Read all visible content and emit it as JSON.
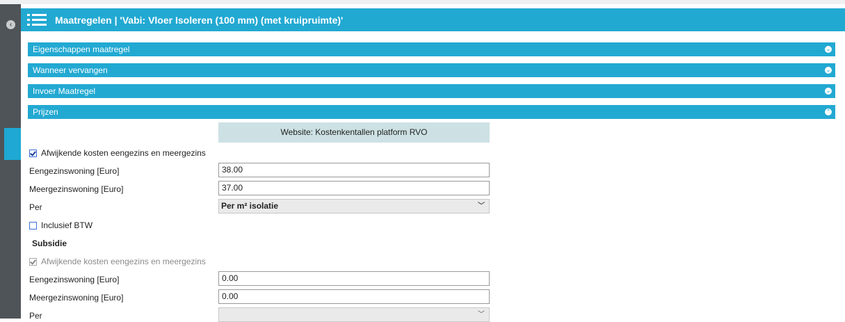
{
  "header": {
    "title": "Maatregelen | 'Vabi: Vloer Isoleren (100 mm) (met kruipruimte)'"
  },
  "sections": [
    {
      "label": "Eigenschappen maatregel",
      "state": "collapsed"
    },
    {
      "label": "Wanneer vervangen",
      "state": "collapsed"
    },
    {
      "label": "Invoer Maatregel",
      "state": "collapsed"
    },
    {
      "label": "Prijzen",
      "state": "expanded"
    }
  ],
  "prijzen": {
    "website_button": "Website: Kostenkentallen platform RVO",
    "afwijkende_label": "Afwijkende kosten eengezins en meergezins",
    "eengezins_label": "Eengezinswoning [Euro]",
    "eengezins_value": "38.00",
    "meergezins_label": "Meergezinswoning [Euro]",
    "meergezins_value": "37.00",
    "per_label": "Per",
    "per_value": "Per m² isolatie",
    "btw_label": "Inclusief BTW"
  },
  "subsidie": {
    "heading": "Subsidie",
    "afwijkende_label": "Afwijkende kosten eengezins en meergezins",
    "eengezins_label": "Eengezinswoning [Euro]",
    "eengezins_value": "0.00",
    "meergezins_label": "Meergezinswoning [Euro]",
    "meergezins_value": "0.00",
    "per_label": "Per",
    "per_value": ""
  },
  "icons": {
    "collapse": "chevron-left-icon",
    "menu": "list-menu-icon",
    "expand": "chevron-down-circle-icon",
    "collapse_section": "chevron-up-circle-icon"
  },
  "colors": {
    "accent": "#22a9d2",
    "sidebar": "#4f5458",
    "button_bg": "#cde1e4"
  }
}
